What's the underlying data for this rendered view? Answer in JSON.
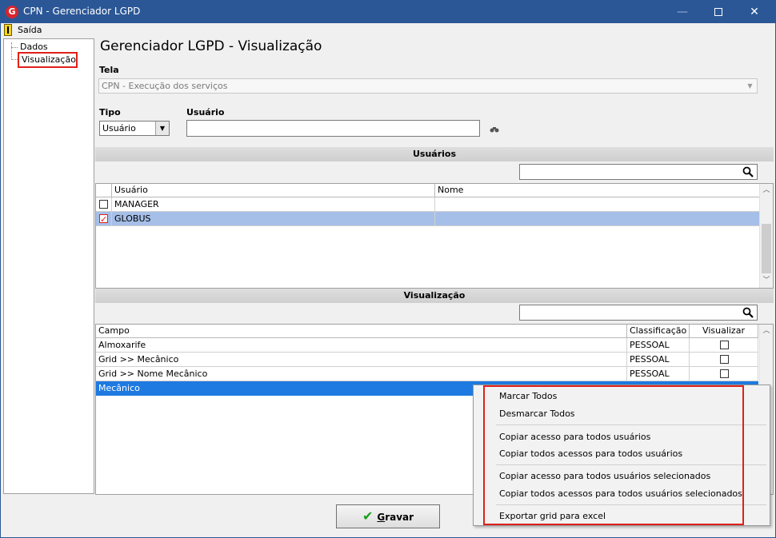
{
  "window": {
    "title": "CPN - Gerenciador LGPD",
    "app_icon_letter": "G"
  },
  "menubar": {
    "exit_label": "Saída"
  },
  "tree": {
    "items": [
      {
        "label": "Dados"
      },
      {
        "label": "Visualização"
      }
    ]
  },
  "page": {
    "title": "Gerenciador LGPD - Visualização"
  },
  "form": {
    "tela_label": "Tela",
    "tela_value": "CPN - Execução dos serviços",
    "tipo_label": "Tipo",
    "tipo_value": "Usuário",
    "usuario_label": "Usuário",
    "usuario_value": ""
  },
  "users_section": {
    "title": "Usuários",
    "search_value": "",
    "columns": [
      "Usuário",
      "Nome"
    ],
    "rows": [
      {
        "usuario": "MANAGER",
        "nome": "",
        "checked": false
      },
      {
        "usuario": "GLOBUS",
        "nome": "",
        "checked": true
      }
    ]
  },
  "vis_section": {
    "title": "Visualização",
    "search_value": "",
    "columns": [
      "Campo",
      "Classificação",
      "Visualizar"
    ],
    "rows": [
      {
        "campo": "Almoxarife",
        "classificacao": "PESSOAL"
      },
      {
        "campo": "Grid >> Mecânico",
        "classificacao": "PESSOAL"
      },
      {
        "campo": "Grid >> Nome Mecânico",
        "classificacao": "PESSOAL"
      },
      {
        "campo": "Mecânico",
        "classificacao": ""
      }
    ]
  },
  "buttons": {
    "gravar_prefix": "",
    "gravar_underlined": "G",
    "gravar_rest": "ravar"
  },
  "context_menu": {
    "items": [
      "Marcar Todos",
      "Desmarcar Todos",
      "Copiar acesso para todos usuários",
      "Copiar todos acessos para todos usuários",
      "Copiar acesso para todos usuários selecionados",
      "Copiar todos acessos para todos usuários selecionados",
      "Exportar grid para excel"
    ]
  },
  "colors": {
    "titlebar": "#2b5797",
    "selected_row_users": "#a6bfe8",
    "selected_row_vis": "#1e7ae0",
    "highlight_box": "#e0201a"
  }
}
